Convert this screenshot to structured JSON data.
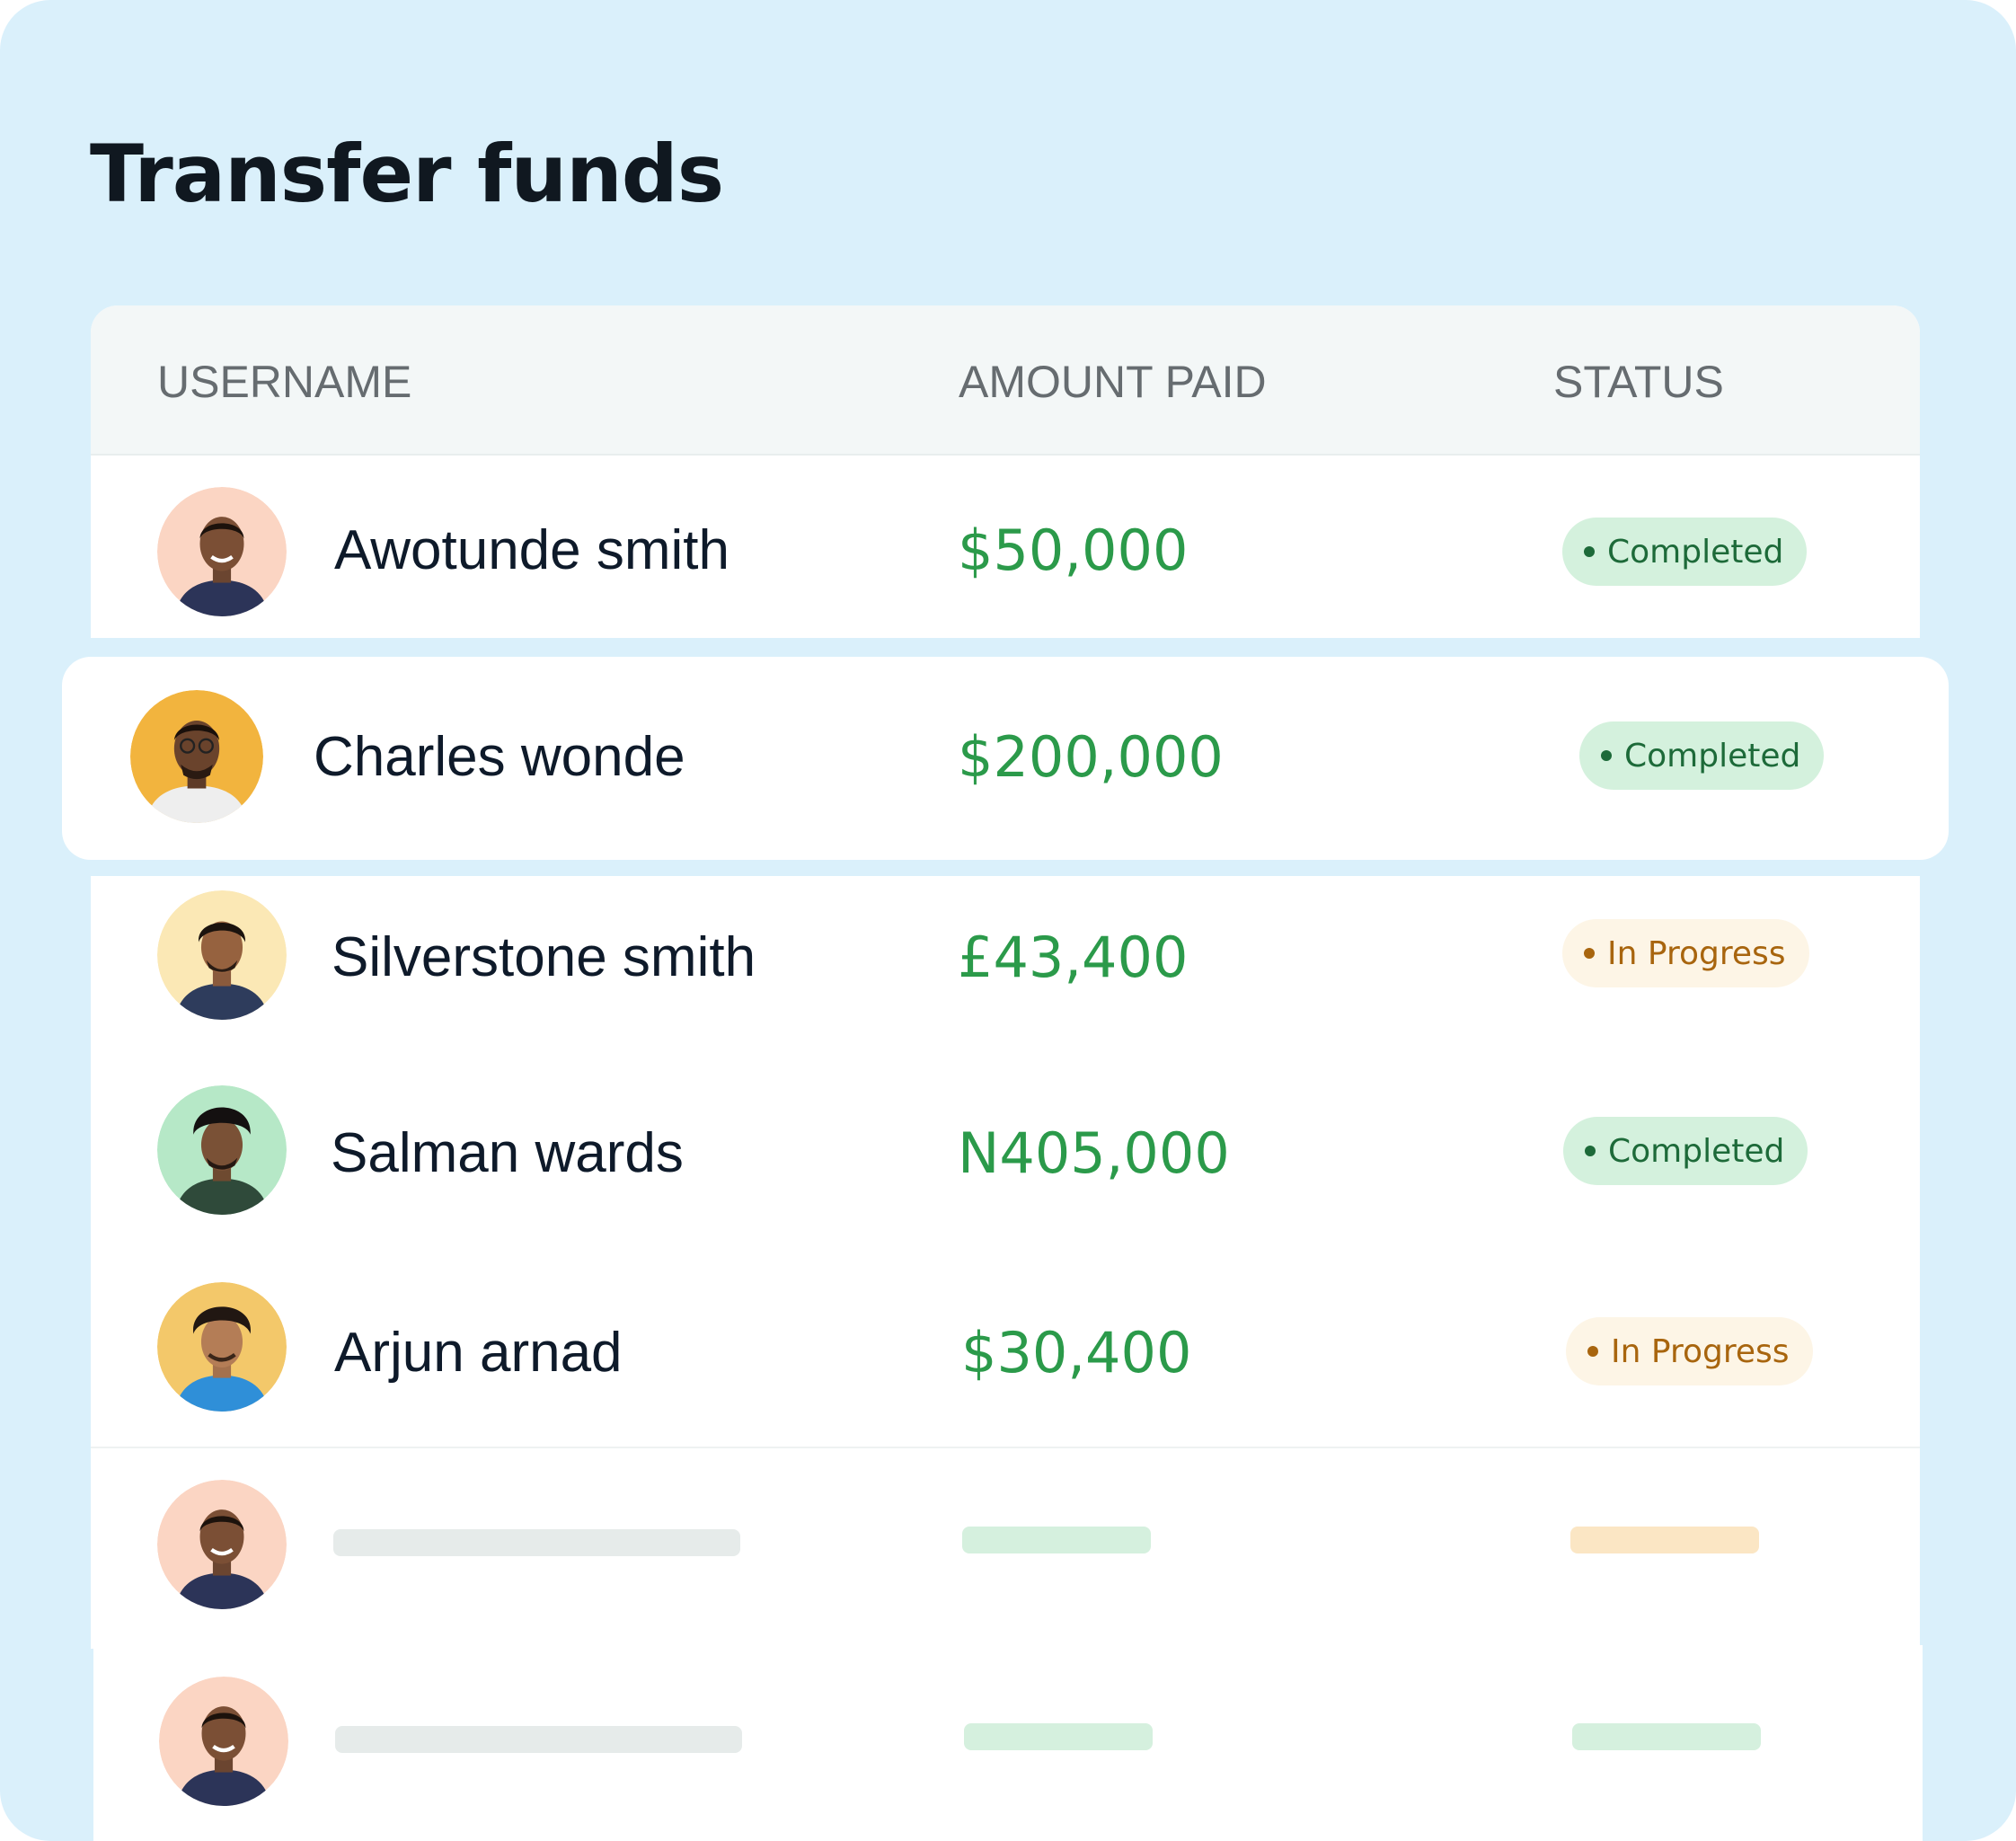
{
  "title": "Transfer funds",
  "columns": {
    "username": "USERNAME",
    "amount": "AMOUNT PAID",
    "status": "STATUS"
  },
  "rows": [
    {
      "name": "Awotunde smith",
      "amount": "$50,000",
      "status": "Completed",
      "avatar_bg": "#fbd5c3"
    },
    {
      "name": "Charles wonde",
      "amount": "$200,000",
      "status": "Completed",
      "avatar_bg": "#f2b43e"
    },
    {
      "name": "Silverstone smith",
      "amount": "£43,400",
      "status": "In Progress",
      "avatar_bg": "#fbe8b5"
    },
    {
      "name": "Salman wards",
      "amount": "N405,000",
      "status": "Completed",
      "avatar_bg": "#b6e8c7"
    },
    {
      "name": "Arjun arnad",
      "amount": "$30,400",
      "status": "In Progress",
      "avatar_bg": "#f3c86a"
    }
  ],
  "colors": {
    "background": "#daf0fb",
    "amount_green": "#2b9a4a",
    "completed_bg": "#d4f1dd",
    "completed_text": "#1d6a39",
    "progress_bg": "#fdf5e6",
    "progress_text": "#a8650e",
    "skeleton_gray": "#e6ebea",
    "skeleton_green": "#d5f0de",
    "skeleton_orange": "#fbe6c4"
  }
}
